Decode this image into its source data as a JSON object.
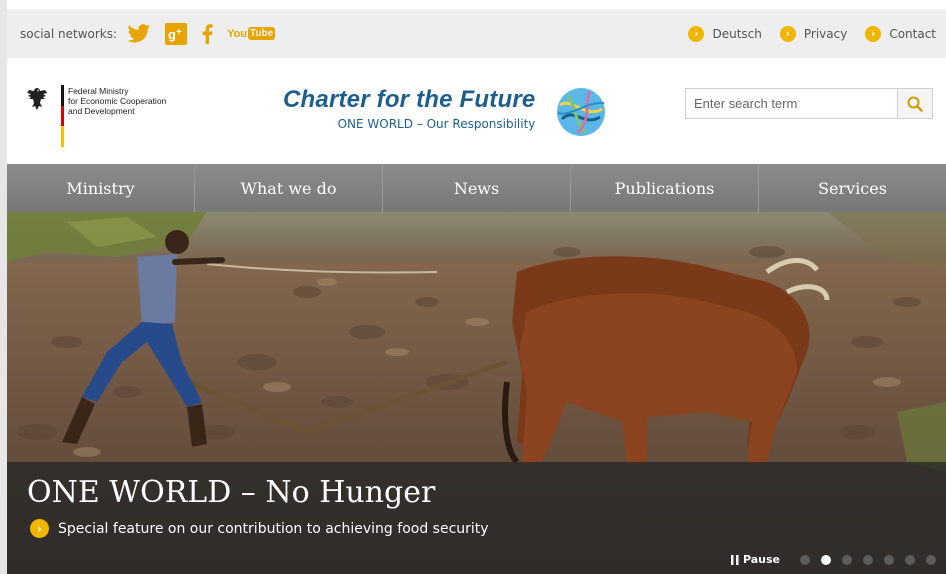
{
  "topbar": {
    "social_label": "social networks:",
    "social_icons": [
      "twitter-icon",
      "google-plus-icon",
      "facebook-icon",
      "youtube-icon"
    ],
    "youtube_you": "You",
    "youtube_tube": "Tube",
    "links": [
      "Deutsch",
      "Privacy",
      "Contact"
    ]
  },
  "header": {
    "ministry_lines": [
      "Federal Ministry",
      "for Economic Cooperation",
      "and Development"
    ],
    "charter_title": "Charter for the Future",
    "charter_subtitle": "ONE WORLD – Our Responsibility",
    "search_placeholder": "Enter search term"
  },
  "nav": {
    "items": [
      "Ministry",
      "What we do",
      "News",
      "Publications",
      "Services"
    ]
  },
  "hero": {
    "title": "ONE WORLD – No Hunger",
    "link_text": "Special feature on our contribution to achieving food security",
    "pause_label": "Pause",
    "active_slide": 2,
    "slide_count": 7
  },
  "colors": {
    "accent": "#f0b600",
    "brand_blue": "#1d5f8c",
    "nav_bg": "#828282"
  }
}
